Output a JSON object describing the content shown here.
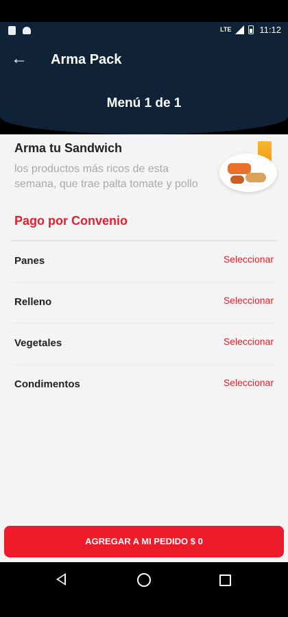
{
  "status_bar": {
    "network": "LTE",
    "time": "11:12"
  },
  "header": {
    "title": "Arma Pack",
    "menu_counter": "Menú 1 de 1"
  },
  "product": {
    "title": "Arma tu Sandwich",
    "description": "los productos más ricos de esta semana, que trae palta tomate y pollo",
    "payment_tag": "Pago por Convenio"
  },
  "options": [
    {
      "label": "Panes",
      "action": "Seleccionar"
    },
    {
      "label": "Relleno",
      "action": "Seleccionar"
    },
    {
      "label": "Vegetales",
      "action": "Seleccionar"
    },
    {
      "label": "Condimentos",
      "action": "Seleccionar"
    }
  ],
  "add_button": {
    "label": "AGREGAR A MI PEDIDO $ 0"
  },
  "colors": {
    "header_bg": "#0f2237",
    "accent_red": "#e3202b",
    "button_red": "#ee1c2a"
  },
  "icons": [
    "sim-icon",
    "android-icon",
    "signal-icon",
    "battery-icon",
    "back-arrow-icon",
    "nav-back-icon",
    "nav-home-icon",
    "nav-recent-icon"
  ]
}
